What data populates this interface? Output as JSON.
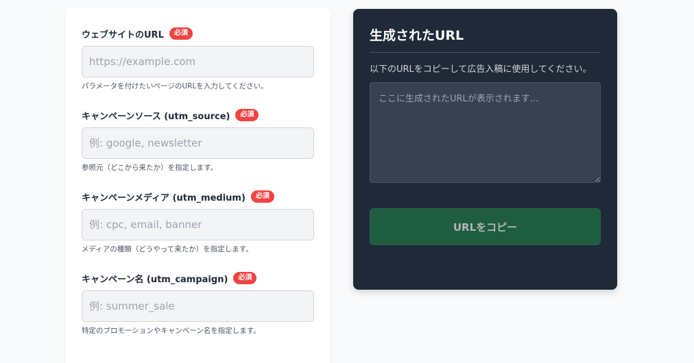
{
  "form": {
    "required_badge": "必須",
    "fields": [
      {
        "label": "ウェブサイトのURL",
        "placeholder": "https://example.com",
        "value": "",
        "help": "パラメータを付けたいページのURLを入力してください。"
      },
      {
        "label": "キャンペーンソース (utm_source)",
        "placeholder": "例: google, newsletter",
        "value": "",
        "help": "参照元（どこから来たか）を指定します。"
      },
      {
        "label": "キャンペーンメディア (utm_medium)",
        "placeholder": "例: cpc, email, banner",
        "value": "",
        "help": "メディアの種類（どうやって来たか）を指定します。"
      },
      {
        "label": "キャンペーン名 (utm_campaign)",
        "placeholder": "例: summer_sale",
        "value": "",
        "help": "特定のプロモーションやキャンペーン名を指定します。"
      }
    ]
  },
  "result": {
    "title": "生成されたURL",
    "description": "以下のURLをコピーして広告入稿に使用してください。",
    "placeholder": "ここに生成されたURLが表示されます...",
    "value": "",
    "copy_button_label": "URLをコピー"
  },
  "colors": {
    "badge": "#ef4444",
    "panel_bg": "#1f2937",
    "copy_button": "#1e7a44"
  }
}
